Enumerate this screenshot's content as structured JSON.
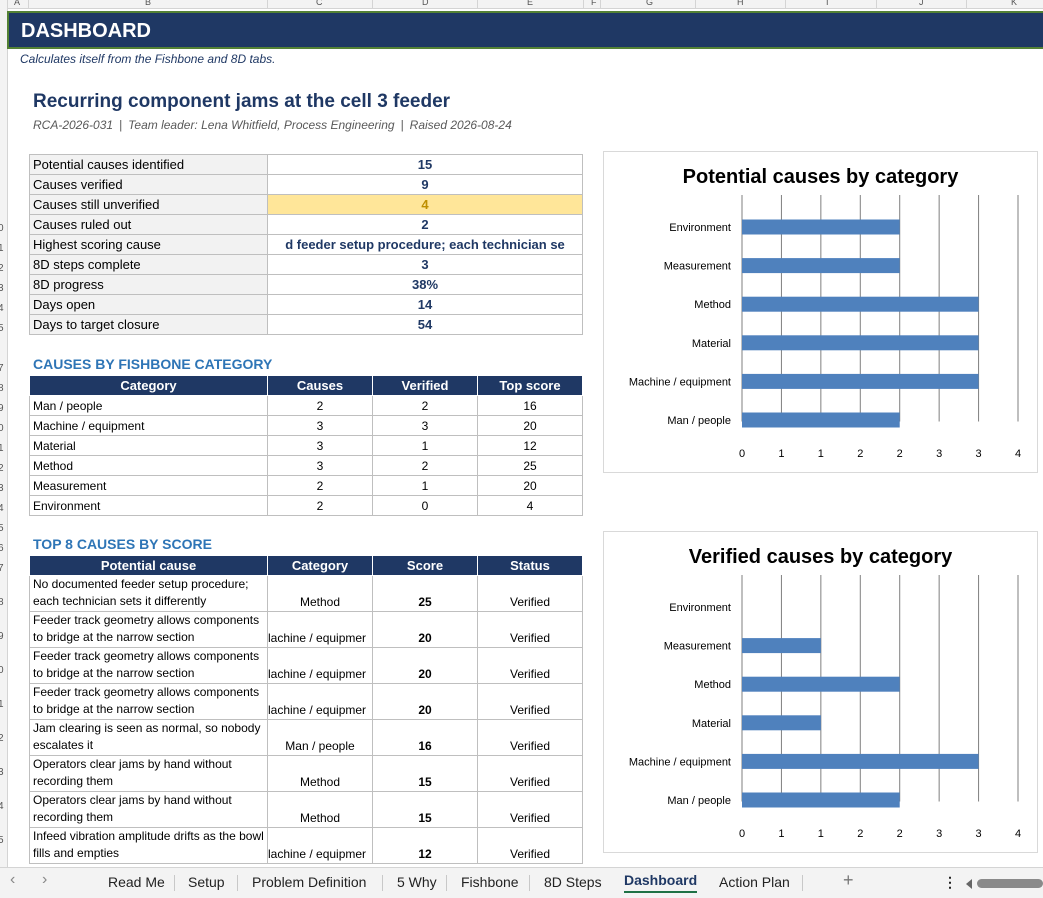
{
  "columns": [
    "A",
    "B",
    "C",
    "D",
    "E",
    "F",
    "G",
    "H",
    "I",
    "J",
    "K"
  ],
  "rows": [
    "0",
    "1",
    "2",
    "3",
    "4",
    "5",
    "7",
    "8",
    "9",
    "0",
    "1",
    "2",
    "3",
    "4",
    "5",
    "6",
    "7",
    "8",
    "9",
    "0",
    "1",
    "2",
    "3",
    "4",
    "5"
  ],
  "banner": {
    "title": "DASHBOARD"
  },
  "subtitle": "Calculates itself from the Fishbone and 8D tabs.",
  "problem": {
    "title": "Recurring component jams at the cell 3 feeder",
    "id": "RCA-2026-031",
    "leader": "Team leader: Lena Whitfield, Process Engineering",
    "raised": "Raised 2026-08-24"
  },
  "kpis": [
    {
      "label": "Potential causes identified",
      "value": "15"
    },
    {
      "label": "Causes verified",
      "value": "9"
    },
    {
      "label": "Causes still unverified",
      "value": "4"
    },
    {
      "label": "Causes ruled out",
      "value": "2"
    },
    {
      "label": "Highest scoring cause",
      "value": "d feeder setup procedure; each technician se"
    },
    {
      "label": "8D steps complete",
      "value": "3"
    },
    {
      "label": "8D progress",
      "value": "38%"
    },
    {
      "label": "Days open",
      "value": "14"
    },
    {
      "label": "Days to target closure",
      "value": "54"
    }
  ],
  "fishbone": {
    "title": "CAUSES BY FISHBONE CATEGORY",
    "headers": [
      "Category",
      "Causes",
      "Verified",
      "Top score"
    ],
    "rows": [
      [
        "Man / people",
        "2",
        "2",
        "16"
      ],
      [
        "Machine / equipment",
        "3",
        "3",
        "20"
      ],
      [
        "Material",
        "3",
        "1",
        "12"
      ],
      [
        "Method",
        "3",
        "2",
        "25"
      ],
      [
        "Measurement",
        "2",
        "1",
        "20"
      ],
      [
        "Environment",
        "2",
        "0",
        "4"
      ]
    ]
  },
  "top8": {
    "title": "TOP 8 CAUSES BY SCORE",
    "headers": [
      "Potential cause",
      "Category",
      "Score",
      "Status"
    ],
    "rows": [
      [
        "No documented feeder setup procedure; each technician sets it differently",
        "Method",
        "25",
        "Verified"
      ],
      [
        "Feeder track geometry allows components to bridge at the narrow section",
        "lachine / equipmer",
        "20",
        "Verified"
      ],
      [
        "Feeder track geometry allows components to bridge at the narrow section",
        "lachine / equipmer",
        "20",
        "Verified"
      ],
      [
        "Feeder track geometry allows components to bridge at the narrow section",
        "lachine / equipmer",
        "20",
        "Verified"
      ],
      [
        "Jam clearing is seen as normal, so nobody escalates it",
        "Man / people",
        "16",
        "Verified"
      ],
      [
        "Operators clear jams by hand without recording them",
        "Method",
        "15",
        "Verified"
      ],
      [
        "Operators clear jams by hand without recording them",
        "Method",
        "15",
        "Verified"
      ],
      [
        "Infeed vibration amplitude drifts as the bowl fills and empties",
        "lachine / equipmer",
        "12",
        "Verified"
      ]
    ]
  },
  "chart_data": [
    {
      "type": "bar",
      "orientation": "horizontal",
      "title": "Potential causes by category",
      "categories": [
        "Environment",
        "Measurement",
        "Method",
        "Material",
        "Machine / equipment",
        "Man / people"
      ],
      "values": [
        2,
        2,
        3,
        3,
        3,
        2
      ],
      "xlim": [
        0,
        3.5
      ],
      "tick_labels": [
        "0",
        "1",
        "1",
        "2",
        "2",
        "3",
        "3",
        "4"
      ],
      "grid": true,
      "color": "#4f81bd"
    },
    {
      "type": "bar",
      "orientation": "horizontal",
      "title": "Verified causes by category",
      "categories": [
        "Environment",
        "Measurement",
        "Method",
        "Material",
        "Machine / equipment",
        "Man / people"
      ],
      "values": [
        0,
        1,
        2,
        1,
        3,
        2
      ],
      "xlim": [
        0,
        3.5
      ],
      "tick_labels": [
        "0",
        "1",
        "1",
        "2",
        "2",
        "3",
        "3",
        "4"
      ],
      "grid": true,
      "color": "#4f81bd"
    }
  ],
  "tabs": [
    {
      "label": "Read Me"
    },
    {
      "label": "Setup"
    },
    {
      "label": "Problem Definition"
    },
    {
      "label": "5 Why"
    },
    {
      "label": "Fishbone"
    },
    {
      "label": "8D Steps"
    },
    {
      "label": "Dashboard",
      "active": true
    },
    {
      "label": "Action Plan"
    }
  ],
  "tab_add": "+",
  "tab_more": "⋮",
  "nav_prev": "‹",
  "nav_next": "›"
}
